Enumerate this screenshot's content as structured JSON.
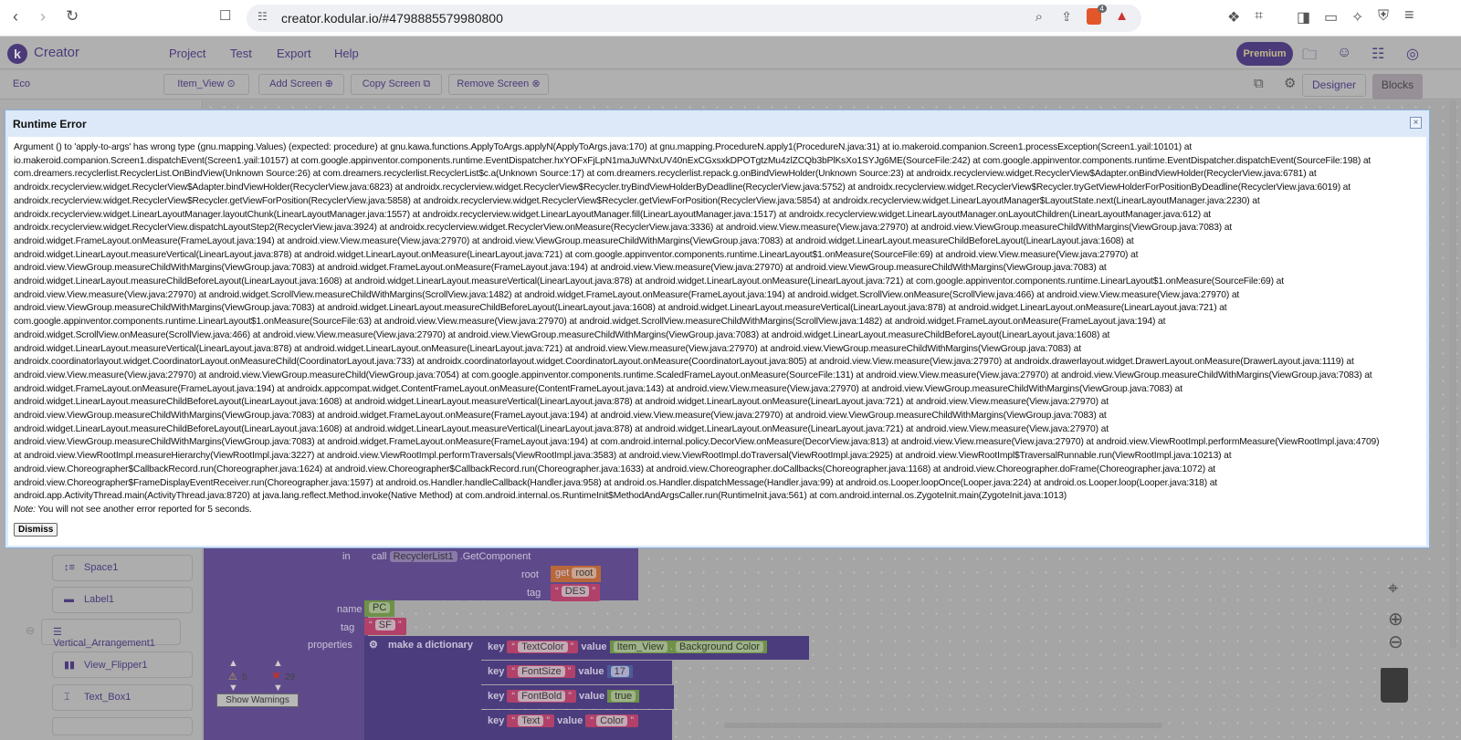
{
  "browser": {
    "url": "creator.kodular.io/#4798885579980800",
    "brave_badge": "4"
  },
  "app": {
    "logo_letter": "k",
    "title": "Creator",
    "menu": [
      "Project",
      "Test",
      "Export",
      "Help"
    ],
    "premium": "Premium"
  },
  "toolbar": {
    "project": "Eco",
    "screen": "Item_View",
    "add_screen": "Add Screen",
    "copy_screen": "Copy Screen",
    "remove_screen": "Remove Screen",
    "designer": "Designer",
    "blocks": "Blocks"
  },
  "components": [
    "Space1",
    "Label1",
    "Vertical_Arrangement1",
    "View_Flipper1",
    "Text_Box1"
  ],
  "warnings": {
    "warn_count": "5",
    "error_count": "29",
    "show_warnings": "Show Warnings"
  },
  "blocks": {
    "in": "in",
    "call": "call",
    "component": "RecyclerList1",
    "method": ".GetComponent",
    "root": "root",
    "get": "get",
    "root_var": "root",
    "tag": "tag",
    "des": "DES",
    "name": "name",
    "pc": "PC",
    "sf": "SF",
    "properties": "properties",
    "make_dict": "make a dictionary",
    "key": "key",
    "value": "value",
    "pairs": [
      {
        "key": "TextColor",
        "comp": "Item_View",
        "prop": "Background Color"
      },
      {
        "key": "FontSize",
        "num": "17"
      },
      {
        "key": "FontBold",
        "bool": "true"
      },
      {
        "key": "Text",
        "text": "Color"
      }
    ]
  },
  "dialog": {
    "title": "Runtime Error",
    "close": "×",
    "note_label": "Note:",
    "note": " You will not see another error reported for 5 seconds.",
    "dismiss": "Dismiss",
    "lines": [
      "Argument () to 'apply-to-args' has wrong type (gnu.mapping.Values) (expected: procedure) at gnu.kawa.functions.ApplyToArgs.applyN(ApplyToArgs.java:170) at gnu.mapping.ProcedureN.apply1(ProcedureN.java:31) at io.makeroid.companion.Screen1.processException(Screen1.yail:10101) at",
      "io.makeroid.companion.Screen1.dispatchEvent(Screen1.yail:10157) at com.google.appinventor.components.runtime.EventDispatcher.hxYOFxFjLpN1maJuWNxUV40nExCGxsxkDPOTgtzMu4zlZCQb3bPlKsXo1SYJg6ME(SourceFile:242) at com.google.appinventor.components.runtime.EventDispatcher.dispatchEvent(SourceFile:198) at",
      "com.dreamers.recyclerlist.RecyclerList.OnBindView(Unknown Source:26) at com.dreamers.recyclerlist.RecyclerList$c.a(Unknown Source:17) at com.dreamers.recyclerlist.repack.g.onBindViewHolder(Unknown Source:23) at androidx.recyclerview.widget.RecyclerView$Adapter.onBindViewHolder(RecyclerView.java:6781) at",
      "androidx.recyclerview.widget.RecyclerView$Adapter.bindViewHolder(RecyclerView.java:6823) at androidx.recyclerview.widget.RecyclerView$Recycler.tryBindViewHolderByDeadline(RecyclerView.java:5752) at androidx.recyclerview.widget.RecyclerView$Recycler.tryGetViewHolderForPositionByDeadline(RecyclerView.java:6019) at",
      "androidx.recyclerview.widget.RecyclerView$Recycler.getViewForPosition(RecyclerView.java:5858) at androidx.recyclerview.widget.RecyclerView$Recycler.getViewForPosition(RecyclerView.java:5854) at androidx.recyclerview.widget.LinearLayoutManager$LayoutState.next(LinearLayoutManager.java:2230) at",
      "androidx.recyclerview.widget.LinearLayoutManager.layoutChunk(LinearLayoutManager.java:1557) at androidx.recyclerview.widget.LinearLayoutManager.fill(LinearLayoutManager.java:1517) at androidx.recyclerview.widget.LinearLayoutManager.onLayoutChildren(LinearLayoutManager.java:612) at",
      "androidx.recyclerview.widget.RecyclerView.dispatchLayoutStep2(RecyclerView.java:3924) at androidx.recyclerview.widget.RecyclerView.onMeasure(RecyclerView.java:3336) at android.view.View.measure(View.java:27970) at android.view.ViewGroup.measureChildWithMargins(ViewGroup.java:7083) at",
      "android.widget.FrameLayout.onMeasure(FrameLayout.java:194) at android.view.View.measure(View.java:27970) at android.view.ViewGroup.measureChildWithMargins(ViewGroup.java:7083) at android.widget.LinearLayout.measureChildBeforeLayout(LinearLayout.java:1608) at",
      "android.widget.LinearLayout.measureVertical(LinearLayout.java:878) at android.widget.LinearLayout.onMeasure(LinearLayout.java:721) at com.google.appinventor.components.runtime.LinearLayout$1.onMeasure(SourceFile:69) at android.view.View.measure(View.java:27970) at",
      "android.view.ViewGroup.measureChildWithMargins(ViewGroup.java:7083) at android.widget.FrameLayout.onMeasure(FrameLayout.java:194) at android.view.View.measure(View.java:27970) at android.view.ViewGroup.measureChildWithMargins(ViewGroup.java:7083) at",
      "android.widget.LinearLayout.measureChildBeforeLayout(LinearLayout.java:1608) at android.widget.LinearLayout.measureVertical(LinearLayout.java:878) at android.widget.LinearLayout.onMeasure(LinearLayout.java:721) at com.google.appinventor.components.runtime.LinearLayout$1.onMeasure(SourceFile:69) at",
      "android.view.View.measure(View.java:27970) at android.widget.ScrollView.measureChildWithMargins(ScrollView.java:1482) at android.widget.FrameLayout.onMeasure(FrameLayout.java:194) at android.widget.ScrollView.onMeasure(ScrollView.java:466) at android.view.View.measure(View.java:27970) at",
      "android.view.ViewGroup.measureChildWithMargins(ViewGroup.java:7083) at android.widget.LinearLayout.measureChildBeforeLayout(LinearLayout.java:1608) at android.widget.LinearLayout.measureVertical(LinearLayout.java:878) at android.widget.LinearLayout.onMeasure(LinearLayout.java:721) at",
      "com.google.appinventor.components.runtime.LinearLayout$1.onMeasure(SourceFile:63) at android.view.View.measure(View.java:27970) at android.widget.ScrollView.measureChildWithMargins(ScrollView.java:1482) at android.widget.FrameLayout.onMeasure(FrameLayout.java:194) at",
      "android.widget.ScrollView.onMeasure(ScrollView.java:466) at android.view.View.measure(View.java:27970) at android.view.ViewGroup.measureChildWithMargins(ViewGroup.java:7083) at android.widget.LinearLayout.measureChildBeforeLayout(LinearLayout.java:1608) at",
      "android.widget.LinearLayout.measureVertical(LinearLayout.java:878) at android.widget.LinearLayout.onMeasure(LinearLayout.java:721) at android.view.View.measure(View.java:27970) at android.view.ViewGroup.measureChildWithMargins(ViewGroup.java:7083) at",
      "androidx.coordinatorlayout.widget.CoordinatorLayout.onMeasureChild(CoordinatorLayout.java:733) at androidx.coordinatorlayout.widget.CoordinatorLayout.onMeasure(CoordinatorLayout.java:805) at android.view.View.measure(View.java:27970) at androidx.drawerlayout.widget.DrawerLayout.onMeasure(DrawerLayout.java:1119) at",
      "android.view.View.measure(View.java:27970) at android.view.ViewGroup.measureChild(ViewGroup.java:7054) at com.google.appinventor.components.runtime.ScaledFrameLayout.onMeasure(SourceFile:131) at android.view.View.measure(View.java:27970) at android.view.ViewGroup.measureChildWithMargins(ViewGroup.java:7083) at",
      "android.widget.FrameLayout.onMeasure(FrameLayout.java:194) at androidx.appcompat.widget.ContentFrameLayout.onMeasure(ContentFrameLayout.java:143) at android.view.View.measure(View.java:27970) at android.view.ViewGroup.measureChildWithMargins(ViewGroup.java:7083) at",
      "android.widget.LinearLayout.measureChildBeforeLayout(LinearLayout.java:1608) at android.widget.LinearLayout.measureVertical(LinearLayout.java:878) at android.widget.LinearLayout.onMeasure(LinearLayout.java:721) at android.view.View.measure(View.java:27970) at",
      "android.view.ViewGroup.measureChildWithMargins(ViewGroup.java:7083) at android.widget.FrameLayout.onMeasure(FrameLayout.java:194) at android.view.View.measure(View.java:27970) at android.view.ViewGroup.measureChildWithMargins(ViewGroup.java:7083) at",
      "android.widget.LinearLayout.measureChildBeforeLayout(LinearLayout.java:1608) at android.widget.LinearLayout.measureVertical(LinearLayout.java:878) at android.widget.LinearLayout.onMeasure(LinearLayout.java:721) at android.view.View.measure(View.java:27970) at",
      "android.view.ViewGroup.measureChildWithMargins(ViewGroup.java:7083) at android.widget.FrameLayout.onMeasure(FrameLayout.java:194) at com.android.internal.policy.DecorView.onMeasure(DecorView.java:813) at android.view.View.measure(View.java:27970) at android.view.ViewRootImpl.performMeasure(ViewRootImpl.java:4709)",
      "at android.view.ViewRootImpl.measureHierarchy(ViewRootImpl.java:3227) at android.view.ViewRootImpl.performTraversals(ViewRootImpl.java:3583) at android.view.ViewRootImpl.doTraversal(ViewRootImpl.java:2925) at android.view.ViewRootImpl$TraversalRunnable.run(ViewRootImpl.java:10213) at",
      "android.view.Choreographer$CallbackRecord.run(Choreographer.java:1624) at android.view.Choreographer$CallbackRecord.run(Choreographer.java:1633) at android.view.Choreographer.doCallbacks(Choreographer.java:1168) at android.view.Choreographer.doFrame(Choreographer.java:1072) at",
      "android.view.Choreographer$FrameDisplayEventReceiver.run(Choreographer.java:1597) at android.os.Handler.handleCallback(Handler.java:958) at android.os.Handler.dispatchMessage(Handler.java:99) at android.os.Looper.loopOnce(Looper.java:224) at android.os.Looper.loop(Looper.java:318) at",
      "android.app.ActivityThread.main(ActivityThread.java:8720) at java.lang.reflect.Method.invoke(Native Method) at com.android.internal.os.RuntimeInit$MethodAndArgsCaller.run(RuntimeInit.java:561) at com.android.internal.os.ZygoteInit.main(ZygoteInit.java:1013)"
    ]
  }
}
